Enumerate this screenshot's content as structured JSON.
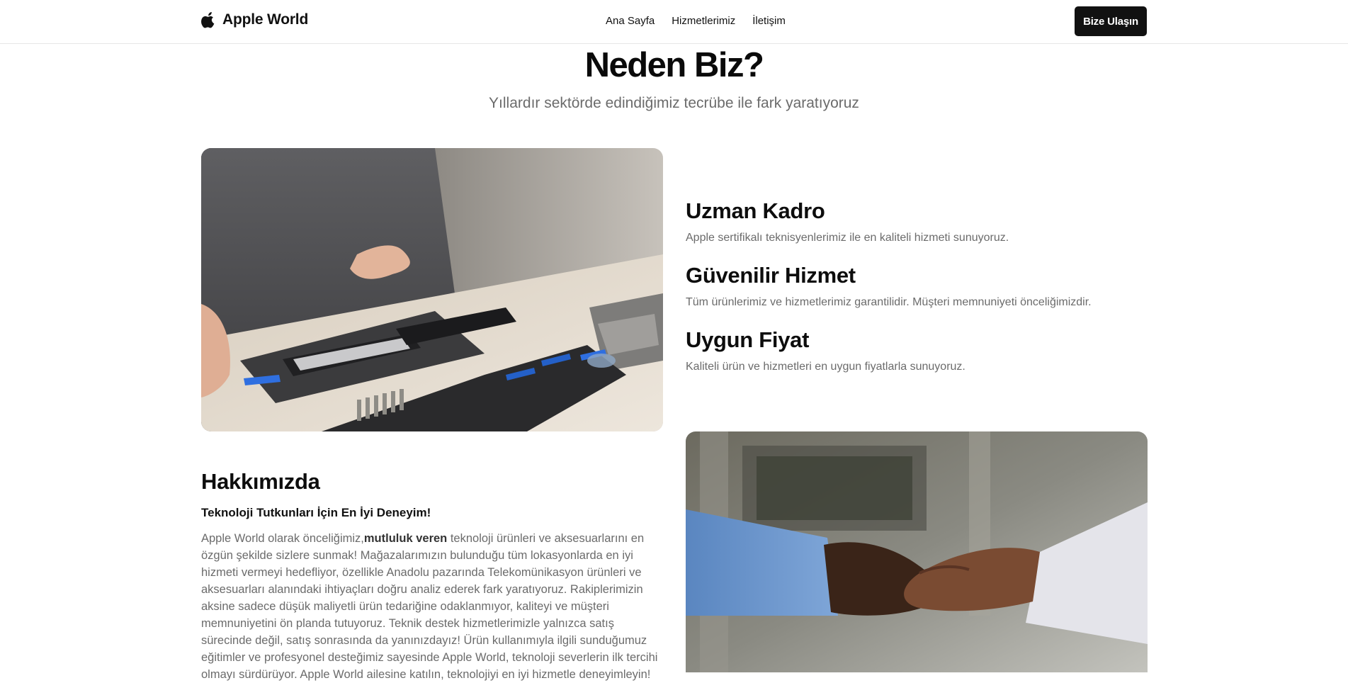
{
  "header": {
    "brand": "Apple World",
    "nav": [
      "Ana Sayfa",
      "Hizmetlerimiz",
      "İletişim"
    ],
    "cta": "Bize Ulaşın"
  },
  "why": {
    "title": "Neden Biz?",
    "subtitle": "Yıllardır sektörde edindiğimiz tecrübe ile fark yaratıyoruz"
  },
  "features": [
    {
      "title": "Uzman Kadro",
      "desc": "Apple sertifikalı teknisyenlerimiz ile en kaliteli hizmeti sunuyoruz."
    },
    {
      "title": "Güvenilir Hizmet",
      "desc": "Tüm ürünlerimiz ve hizmetlerimiz garantilidir. Müşteri memnuniyeti önceliğimizdir."
    },
    {
      "title": "Uygun Fiyat",
      "desc": "Kaliteli ürün ve hizmetleri en uygun fiyatlarla sunuyoruz."
    }
  ],
  "about": {
    "title": "Hakkımızda",
    "subtitle": "Teknoloji Tutkunları İçin En İyi Deneyim!",
    "text_before": "Apple World olarak önceliğimiz,",
    "text_bold": "mutluluk veren",
    "text_after": " teknoloji ürünleri ve aksesuarlarını en özgün şekilde sizlere sunmak! Mağazalarımızın bulunduğu tüm lokasyonlarda en iyi hizmeti vermeyi hedefliyor, özellikle Anadolu pazarında Telekomünikasyon ürünleri ve aksesuarları alanındaki ihtiyaçları doğru analiz ederek fark yaratıyoruz. Rakiplerimizin aksine sadece düşük maliyetli ürün tedariğine odaklanmıyor, kaliteyi ve müşteri memnuniyetini ön planda tutuyoruz. Teknik destek hizmetlerimizle yalnızca satış sürecinde değil, satış sonrasında da yanınızdayız! Ürün kullanımıyla ilgili sunduğumuz eğitimler ve profesyonel desteğimiz sayesinde Apple World, teknoloji severlerin ilk tercihi olmayı sürdürüyor. Apple World ailesine katılın, teknolojiyi en iyi hizmetle deneyimleyin!"
  },
  "icons": {
    "brand": "apple-logo-icon"
  },
  "colors": {
    "accent": "#111111",
    "muted_text": "#6b6b6b",
    "border": "#e6e6e6"
  }
}
